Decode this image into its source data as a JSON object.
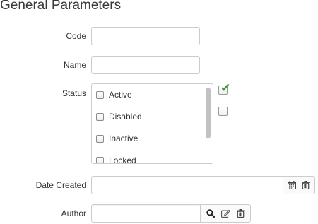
{
  "header": {
    "title": "General Parameters"
  },
  "fields": {
    "code": {
      "label": "Code",
      "value": ""
    },
    "name": {
      "label": "Name",
      "value": ""
    },
    "status": {
      "label": "Status",
      "options": [
        {
          "label": "Active",
          "checked": false
        },
        {
          "label": "Disabled",
          "checked": false
        },
        {
          "label": "Inactive",
          "checked": false
        },
        {
          "label": "Locked",
          "checked": false
        }
      ],
      "side_checkboxes": [
        {
          "checked": true
        },
        {
          "checked": false
        }
      ]
    },
    "date_created": {
      "label": "Date Created",
      "value": "",
      "icons": [
        "calendar-icon",
        "trash-icon"
      ]
    },
    "author": {
      "label": "Author",
      "value": "",
      "icons": [
        "search-icon",
        "edit-icon",
        "trash-icon"
      ]
    }
  },
  "colors": {
    "checkmark": "#3a9a35",
    "border": "#cccccc",
    "text": "#333333"
  }
}
